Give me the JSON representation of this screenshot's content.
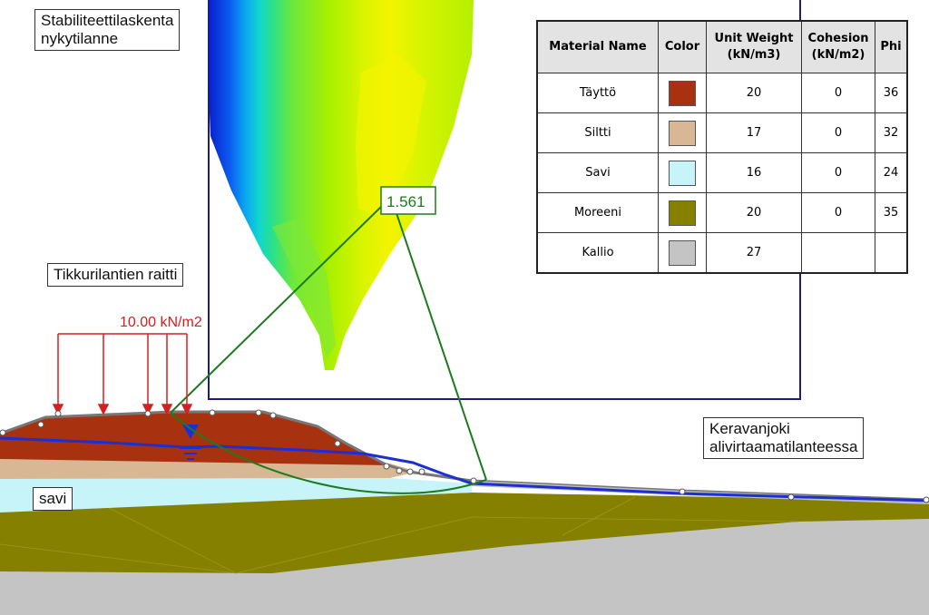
{
  "title_lines": "Stabiliteettilaskenta\nnykytilanne",
  "road_label": "Tikkurilantien raitti",
  "river_label": "Keravanjoki\nalivirtaamatilanteessa",
  "clay_label": "savi",
  "load_label": "10.00 kN/m2",
  "factor_of_safety": "1.561",
  "colors": {
    "taytto": "#a8320f",
    "siltti": "#d8b894",
    "savi": "#c6f4f8",
    "moreeni": "#858000",
    "kallio": "#c4c4c4",
    "water": "#1a2fd6",
    "slip_surface": "#1f7a1f",
    "load": "#d42020",
    "grid_frame": "#1d1d7a"
  },
  "table": {
    "headers": [
      "Material Name",
      "Color",
      "Unit Weight (kN/m3)",
      "Cohesion (kN/m2)",
      "Phi"
    ],
    "rows": [
      {
        "name": "Täyttö",
        "color": "#a8320f",
        "unit_weight": "20",
        "cohesion": "0",
        "phi": "36"
      },
      {
        "name": "Siltti",
        "color": "#d8b894",
        "unit_weight": "17",
        "cohesion": "0",
        "phi": "32"
      },
      {
        "name": "Savi",
        "color": "#c6f4f8",
        "unit_weight": "16",
        "cohesion": "0",
        "phi": "24"
      },
      {
        "name": "Moreeni",
        "color": "#858000",
        "unit_weight": "20",
        "cohesion": "0",
        "phi": "35"
      },
      {
        "name": "Kallio",
        "color": "#c4c4c4",
        "unit_weight": "27",
        "cohesion": "",
        "phi": ""
      }
    ]
  }
}
